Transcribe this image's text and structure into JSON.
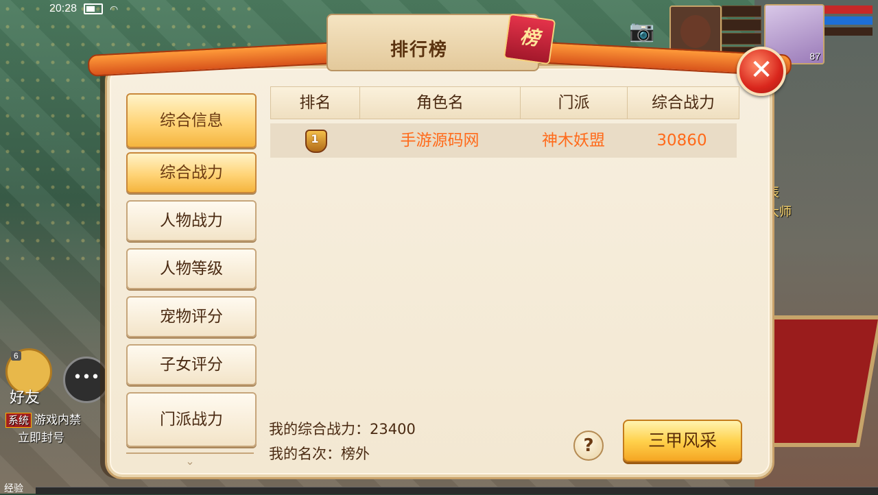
{
  "status_bar": {
    "time": "20:28"
  },
  "hud": {
    "hero_level": "87",
    "hp_color": "#c62828",
    "mp_color": "#1e6fd6"
  },
  "panel": {
    "title": "排行榜",
    "seal_char": "榜"
  },
  "tabs": [
    {
      "label": "综合信息",
      "active": true
    },
    {
      "label": "综合战力",
      "active": true
    },
    {
      "label": "人物战力",
      "active": false
    },
    {
      "label": "人物等级",
      "active": false
    },
    {
      "label": "宠物评分",
      "active": false
    },
    {
      "label": "子女评分",
      "active": false
    },
    {
      "label": "门派战力",
      "active": false
    }
  ],
  "table": {
    "headers": [
      "排名",
      "角色名",
      "门派",
      "综合战力"
    ],
    "rows": [
      {
        "rank": "1",
        "name": "手游源码网",
        "school": "神木妖盟",
        "power": "30860"
      }
    ]
  },
  "footer": {
    "my_power": "我的综合战力：23400",
    "my_rank": "我的名次：榜外",
    "help_label": "?",
    "sanjia_label": "三甲风采"
  },
  "chat": {
    "friend_badge": "6",
    "friend_label": "好友",
    "system_tag": "系统",
    "system_line1": "游戏内禁",
    "system_line2": "立即封号"
  },
  "side_text": [
    "辰",
    "大师"
  ],
  "exp_label": "经验",
  "icons": {
    "close": "close-icon",
    "camera": "camera-icon",
    "chat": "chat-icon",
    "more": "chevron-down-icon"
  }
}
